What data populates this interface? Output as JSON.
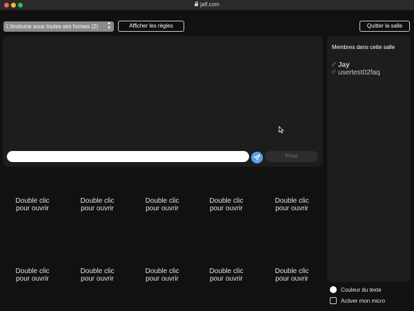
{
  "window": {
    "url": "jalf.com"
  },
  "toolbar": {
    "room_select_value": "L'érotisme sous toutes ses formes (2)",
    "rules_button": "Afficher les règles",
    "quit_button": "Quitter la salle"
  },
  "chat": {
    "message_placeholder": "",
    "private_button": "Privé"
  },
  "video_grid": {
    "cells": [
      {
        "line1": "Double clic",
        "line2": "pour ouvrir"
      },
      {
        "line1": "Double clic",
        "line2": "pour ouvrir"
      },
      {
        "line1": "Double clic",
        "line2": "pour ouvrir"
      },
      {
        "line1": "Double clic",
        "line2": "pour ouvrir"
      },
      {
        "line1": "Double clic",
        "line2": "pour ouvrir"
      },
      {
        "line1": "Double clic",
        "line2": "pour ouvrir"
      },
      {
        "line1": "Double clic",
        "line2": "pour ouvrir"
      },
      {
        "line1": "Double clic",
        "line2": "pour ouvrir"
      },
      {
        "line1": "Double clic",
        "line2": "pour ouvrir"
      },
      {
        "line1": "Double clic",
        "line2": "pour ouvrir"
      }
    ]
  },
  "members": {
    "title": "Membres dans cette salle",
    "gender_symbol": "♂",
    "list": [
      {
        "name": "Jay"
      },
      {
        "name": "usertest02faq"
      }
    ]
  },
  "options": {
    "text_color_label": "Couleur du texte",
    "mic_label": "Activer mon micro"
  },
  "colors": {
    "background": "#111111",
    "panel": "#1d1d1d",
    "accent_send": "#5aa0e6",
    "male_symbol": "#6a9bd8"
  }
}
